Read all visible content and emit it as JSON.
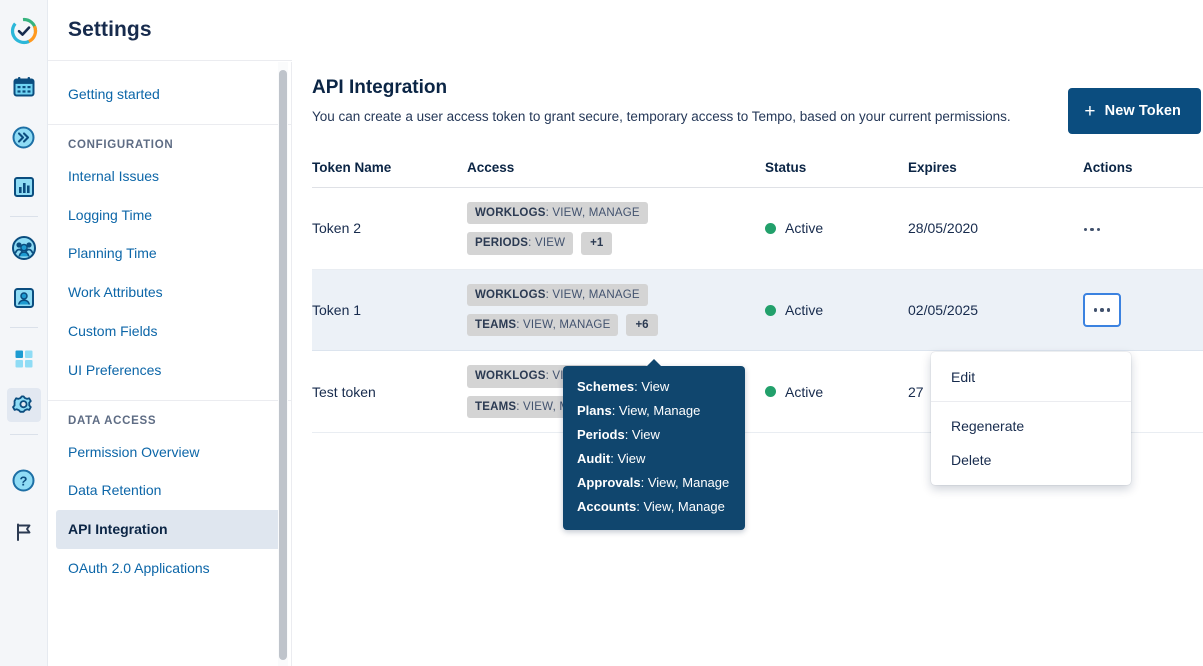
{
  "rail": {
    "items": [
      {
        "name": "tempo-logo-icon",
        "label": "Tempo"
      },
      {
        "name": "calendar-icon",
        "label": "Calendar"
      },
      {
        "name": "chevrons-right-icon",
        "label": "Timesheets"
      },
      {
        "name": "bar-chart-icon",
        "label": "Reports"
      },
      {
        "name": "team-icon",
        "label": "Teams"
      },
      {
        "name": "person-icon",
        "label": "Accounts"
      },
      {
        "name": "apps-grid-icon",
        "label": "Apps"
      },
      {
        "name": "gear-icon",
        "label": "Settings"
      },
      {
        "name": "help-icon",
        "label": "Help"
      },
      {
        "name": "flag-icon",
        "label": "Feedback"
      }
    ]
  },
  "settings": {
    "title": "Settings",
    "nav_top": [
      {
        "label": "Getting started",
        "selected": false
      }
    ],
    "groups": [
      {
        "title": "CONFIGURATION",
        "items": [
          {
            "label": "Internal Issues",
            "selected": false
          },
          {
            "label": "Logging Time",
            "selected": false
          },
          {
            "label": "Planning Time",
            "selected": false
          },
          {
            "label": "Work Attributes",
            "selected": false
          },
          {
            "label": "Custom Fields",
            "selected": false
          },
          {
            "label": "UI Preferences",
            "selected": false
          }
        ]
      },
      {
        "title": "DATA ACCESS",
        "items": [
          {
            "label": "Permission Overview",
            "selected": false
          },
          {
            "label": "Data Retention",
            "selected": false
          },
          {
            "label": "API Integration",
            "selected": true
          },
          {
            "label": "OAuth 2.0 Applications",
            "selected": false
          }
        ]
      }
    ]
  },
  "main": {
    "title": "API Integration",
    "description": "You can create a user access token to grant secure, temporary access to Tempo, based on your current permissions.",
    "new_token_button": "New Token",
    "plus_icon": "+"
  },
  "table": {
    "headers": [
      "Token Name",
      "Access",
      "Status",
      "Expires",
      "Actions"
    ],
    "rows": [
      {
        "name": "Token 2",
        "access": [
          {
            "label": "WORKLOGS",
            "value": "VIEW, MANAGE"
          },
          {
            "label": "PERIODS",
            "value": "VIEW"
          }
        ],
        "more": "+1",
        "status": "Active",
        "status_color": "#22A06B",
        "expires": "28/05/2020",
        "highlighted": false,
        "menu_open": false
      },
      {
        "name": "Token 1",
        "access": [
          {
            "label": "WORKLOGS",
            "value": "VIEW, MANAGE"
          },
          {
            "label": "TEAMS",
            "value": "VIEW, MANAGE"
          }
        ],
        "more": "+6",
        "status": "Active",
        "status_color": "#22A06B",
        "expires": "02/05/2025",
        "highlighted": true,
        "menu_open": true
      },
      {
        "name": "Test token",
        "access": [
          {
            "label": "WORKLOGS",
            "value": "VIEW, MANAGE"
          },
          {
            "label": "TEAMS",
            "value": "VIEW, MANAGE"
          }
        ],
        "more": "",
        "status": "Active",
        "status_color": "#22A06B",
        "expires": "27",
        "highlighted": false,
        "menu_open": false
      }
    ]
  },
  "tooltip": {
    "lines": [
      {
        "label": "Schemes",
        "value": "View"
      },
      {
        "label": "Plans",
        "value": "View, Manage"
      },
      {
        "label": "Periods",
        "value": "View"
      },
      {
        "label": "Audit",
        "value": "View"
      },
      {
        "label": "Approvals",
        "value": "View, Manage"
      },
      {
        "label": "Accounts",
        "value": "View, Manage"
      }
    ],
    "background": "#10466E"
  },
  "menu": {
    "items": [
      "Edit",
      "Regenerate",
      "Delete"
    ]
  },
  "colors": {
    "accent_button": "#0B4D7F",
    "link": "#0C66A8",
    "status_active": "#22A06B",
    "row_highlight": "#ECF1F7",
    "focus_border": "#3B82E0",
    "badge_bg": "#D4D4D4"
  }
}
